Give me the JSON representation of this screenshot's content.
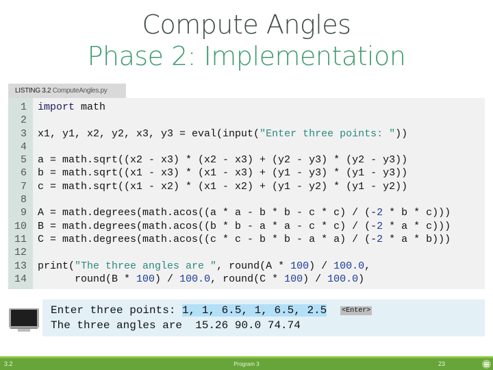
{
  "slide": {
    "title": "Compute Angles",
    "subtitle": "Phase 2: Implementation"
  },
  "listing": {
    "label": "LISTING 3.2",
    "filename": "ComputeAngles.py",
    "lines": [
      {
        "n": "1",
        "parts": [
          {
            "t": "import",
            "c": "kw"
          },
          {
            "t": " math",
            "c": ""
          }
        ]
      },
      {
        "n": "2",
        "parts": []
      },
      {
        "n": "3",
        "parts": [
          {
            "t": "x1, y1, x2, y2, x3, y3 = eval(input(",
            "c": ""
          },
          {
            "t": "\"Enter three points: \"",
            "c": "str"
          },
          {
            "t": "))",
            "c": ""
          }
        ]
      },
      {
        "n": "4",
        "parts": []
      },
      {
        "n": "5",
        "parts": [
          {
            "t": "a = math.sqrt((x2 - x3) * (x2 - x3) + (y2 - y3) * (y2 - y3))",
            "c": ""
          }
        ]
      },
      {
        "n": "6",
        "parts": [
          {
            "t": "b = math.sqrt((x1 - x3) * (x1 - x3) + (y1 - y3) * (y1 - y3))",
            "c": ""
          }
        ]
      },
      {
        "n": "7",
        "parts": [
          {
            "t": "c = math.sqrt((x1 - x2) * (x1 - x2) + (y1 - y2) * (y1 - y2))",
            "c": ""
          }
        ]
      },
      {
        "n": "8",
        "parts": []
      },
      {
        "n": "9",
        "parts": [
          {
            "t": "A = math.degrees(math.acos((a * a - b * b - c * c) / (-",
            "c": ""
          },
          {
            "t": "2",
            "c": "num"
          },
          {
            "t": " * b * c)))",
            "c": ""
          }
        ]
      },
      {
        "n": "10",
        "parts": [
          {
            "t": "B = math.degrees(math.acos((b * b - a * a - c * c) / (-",
            "c": ""
          },
          {
            "t": "2",
            "c": "num"
          },
          {
            "t": " * a * c)))",
            "c": ""
          }
        ]
      },
      {
        "n": "11",
        "parts": [
          {
            "t": "C = math.degrees(math.acos((c * c - b * b - a * a) / (-",
            "c": ""
          },
          {
            "t": "2",
            "c": "num"
          },
          {
            "t": " * a * b)))",
            "c": ""
          }
        ]
      },
      {
        "n": "12",
        "parts": []
      },
      {
        "n": "13",
        "parts": [
          {
            "t": "print(",
            "c": ""
          },
          {
            "t": "\"The three angles are \"",
            "c": "str"
          },
          {
            "t": ", round(A * ",
            "c": ""
          },
          {
            "t": "100",
            "c": "num"
          },
          {
            "t": ") / ",
            "c": ""
          },
          {
            "t": "100.0",
            "c": "num"
          },
          {
            "t": ",",
            "c": ""
          }
        ]
      },
      {
        "n": "14",
        "parts": [
          {
            "t": "      round(B * ",
            "c": ""
          },
          {
            "t": "100",
            "c": "num"
          },
          {
            "t": ") / ",
            "c": ""
          },
          {
            "t": "100.0",
            "c": "num"
          },
          {
            "t": ", round(C * ",
            "c": ""
          },
          {
            "t": "100",
            "c": "num"
          },
          {
            "t": ") / ",
            "c": ""
          },
          {
            "t": "100.0",
            "c": "num"
          },
          {
            "t": ")",
            "c": ""
          }
        ]
      }
    ]
  },
  "output": {
    "icon": "monitor-icon",
    "line1_prompt": "Enter three points: ",
    "line1_input": "1, 1, 6.5, 1, 6.5, 2.5",
    "enter_key": "<Enter>",
    "line2": "The three angles are  15.26 90.0 74.74"
  },
  "footer": {
    "left": "3.2",
    "center": "Program 3",
    "right": "23",
    "menu_icon": "menu-icon"
  },
  "colors": {
    "title": "#404848",
    "subtitle": "#3e9a6e",
    "footer_bg": "#67a53a",
    "code_bg": "#f1f1f1",
    "output_bg": "#e3f1f7"
  }
}
